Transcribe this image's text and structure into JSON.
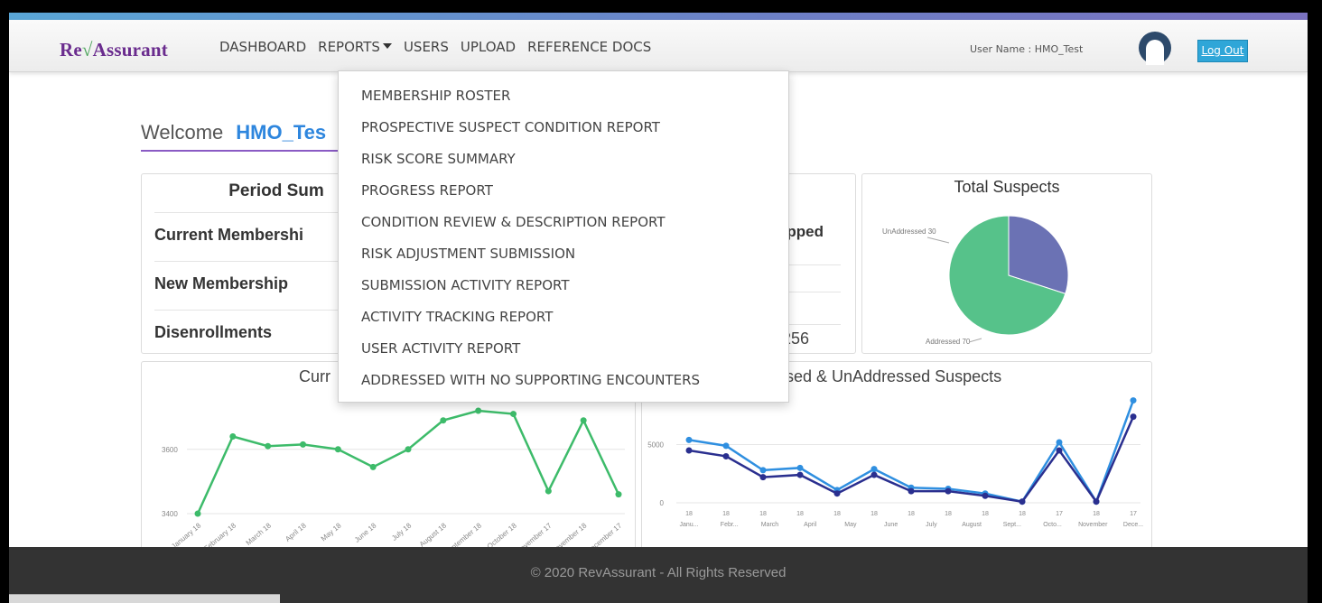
{
  "brand": {
    "logo_pre": "Re",
    "logo_mark": "√",
    "logo_post": "Assurant"
  },
  "nav": {
    "items": [
      {
        "label": "DASHBOARD"
      },
      {
        "label": "REPORTS"
      },
      {
        "label": "USERS"
      },
      {
        "label": "UPLOAD"
      },
      {
        "label": "REFERENCE DOCS"
      }
    ],
    "username_label": "User Name : HMO_Test",
    "logout_label": "Log Out"
  },
  "reports_menu": [
    "MEMBERSHIP ROSTER",
    "PROSPECTIVE SUSPECT CONDITION REPORT",
    "RISK SCORE SUMMARY",
    "PROGRESS REPORT",
    "CONDITION REVIEW & DESCRIPTION REPORT",
    "RISK ADJUSTMENT SUBMISSION",
    "SUBMISSION ACTIVITY REPORT",
    "ACTIVITY TRACKING REPORT",
    "USER ACTIVITY REPORT",
    "ADDRESSED WITH NO SUPPORTING ENCOUNTERS"
  ],
  "welcome": {
    "text": "Welcome",
    "user": "HMO_Tes"
  },
  "period_summary": {
    "title": "Period Sum",
    "rows": [
      "Current Membershi",
      "New Membership",
      "Disenrollments"
    ]
  },
  "middle_card": {
    "dropped_label": "opped",
    "value": ".256"
  },
  "total_suspects": {
    "title": "Total Suspects",
    "chart_data": {
      "type": "pie",
      "labels": [
        "UnAddressed",
        "Addressed"
      ],
      "values": [
        30,
        70
      ],
      "label_texts": [
        "UnAddressed 30",
        "Addressed 70"
      ],
      "colors": [
        "#6b72b4",
        "#56c28a"
      ]
    }
  },
  "line_chart": {
    "title": "Curr",
    "chart_data": {
      "type": "line",
      "categories": [
        "January 18",
        "February 18",
        "March 18",
        "April 18",
        "May 18",
        "June 18",
        "July 18",
        "August 18",
        "September 18",
        "October 18",
        "November 17",
        "November 18",
        "December 17"
      ],
      "values": [
        3400,
        3640,
        3610,
        3615,
        3600,
        3545,
        3600,
        3690,
        3720,
        3710,
        3470,
        3690,
        3460
      ],
      "yticks": [
        3400,
        3600
      ],
      "ylim": [
        3400,
        3720
      ],
      "color": "#3dbb6a"
    }
  },
  "bar_line_chart": {
    "title": "ssed & UnAddressed Suspects",
    "chart_data": {
      "type": "line",
      "categories": [
        "Janu...",
        "Febr...",
        "March",
        "April",
        "May",
        "June",
        "July",
        "August",
        "Sept...",
        "Octo...",
        "November",
        "Dece..."
      ],
      "x_years": [
        "18",
        "18",
        "18",
        "18",
        "18",
        "18",
        "18",
        "18",
        "18",
        "18",
        "17",
        "18",
        "17"
      ],
      "series": [
        {
          "values": [
            5400,
            4900,
            2800,
            3000,
            1100,
            2900,
            1300,
            1200,
            800,
            100,
            5200,
            100,
            8800
          ],
          "color": "#2f8fe0"
        },
        {
          "values": [
            4500,
            4000,
            2200,
            2400,
            800,
            2400,
            1000,
            1000,
            600,
            100,
            4500,
            100,
            7400
          ],
          "color": "#2a2f8f"
        }
      ],
      "yticks": [
        0,
        5000
      ],
      "ylim": [
        0,
        9000
      ]
    }
  },
  "footer": {
    "text": "© 2020 RevAssurant - All Rights Reserved"
  }
}
